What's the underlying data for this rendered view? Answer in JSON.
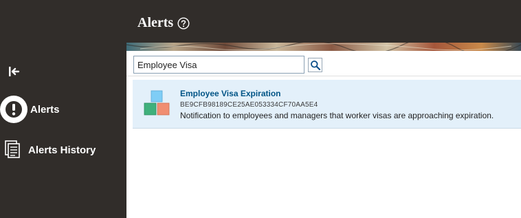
{
  "header": {
    "title": "Alerts",
    "help_icon": "help-circle-icon"
  },
  "sidebar": {
    "collapse_icon": "collapse-left-icon",
    "items": [
      {
        "label": "Alerts",
        "icon": "exclamation-circle-icon",
        "selected": true
      },
      {
        "label": "Alerts History",
        "icon": "history-pages-icon",
        "selected": false
      }
    ]
  },
  "search": {
    "value": "Employee Visa",
    "button_icon": "search-icon"
  },
  "results": [
    {
      "title": "Employee Visa Expiration",
      "id": "BE9CFB98189CE25AE053334CF70AA5E4",
      "description": "Notification to employees and managers that worker visas are approaching expiration.",
      "icon": "blocks-icon"
    }
  ],
  "colors": {
    "sidebar_bg": "#312d2a",
    "selected_row_bg": "#e3f0fa",
    "title_link": "#005486"
  }
}
